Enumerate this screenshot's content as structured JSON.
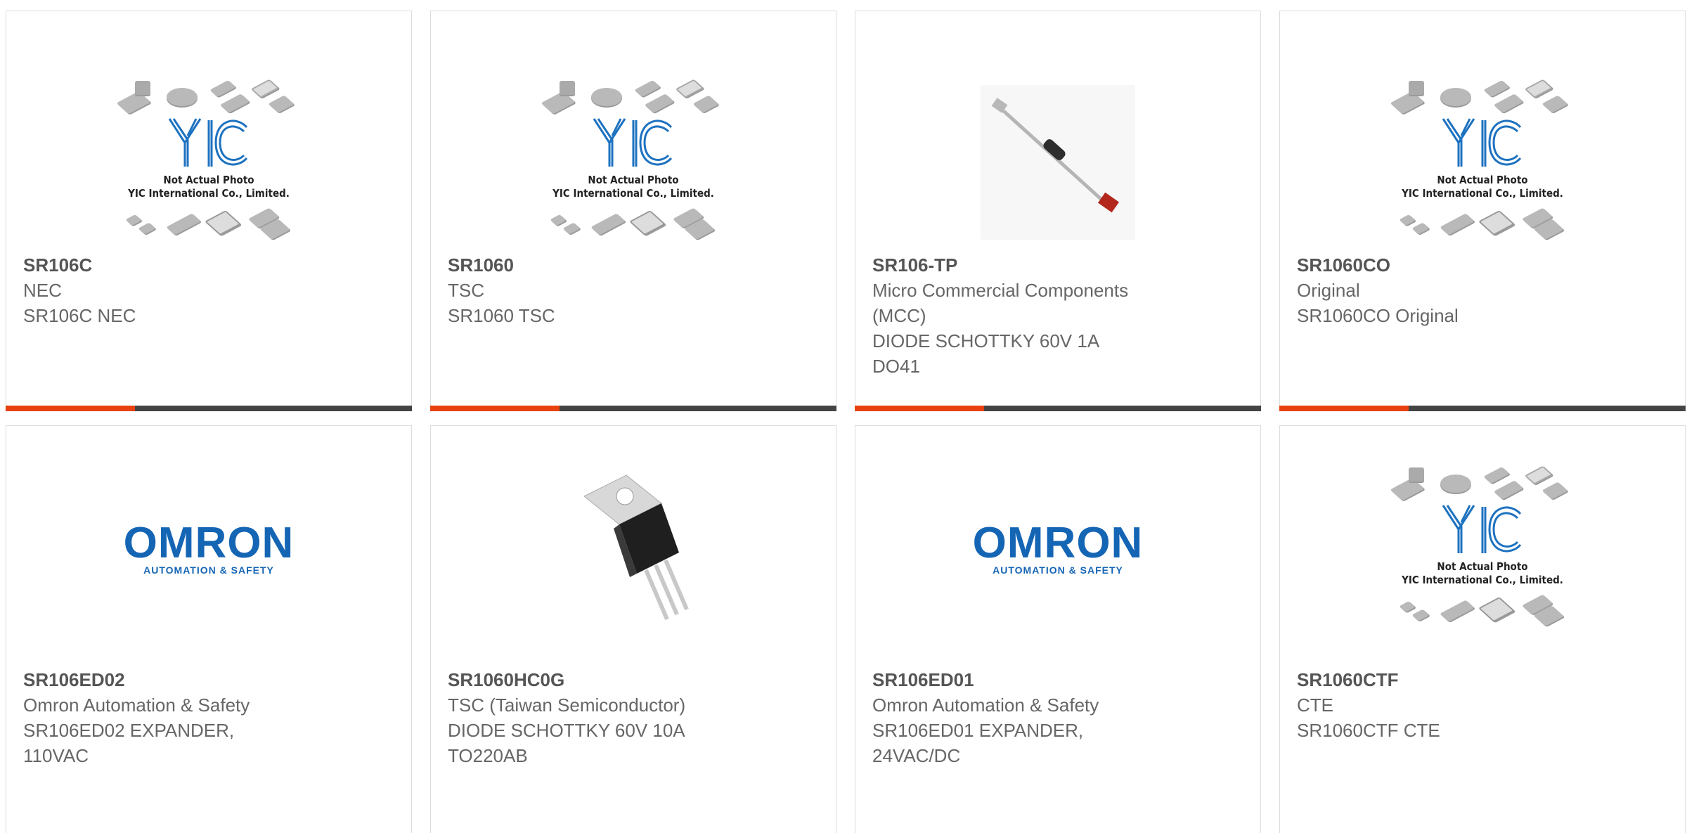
{
  "colors": {
    "accent": "#e8410e",
    "bar": "#444444",
    "border": "#dcdcdc"
  },
  "placeholder": {
    "line1": "Not Actual Photo",
    "line2": "YIC International Co., Limited."
  },
  "omron_logo": {
    "name": "OMRON",
    "tagline": "AUTOMATION & SAFETY"
  },
  "products": [
    {
      "part": "SR106C",
      "manufacturer": "NEC",
      "description": "SR106C NEC",
      "image": "placeholder-icon"
    },
    {
      "part": "SR1060",
      "manufacturer": "TSC",
      "description": "SR1060 TSC",
      "image": "placeholder-icon"
    },
    {
      "part": "SR106-TP",
      "manufacturer": "Micro Commercial Components\n(MCC)",
      "description": "DIODE SCHOTTKY 60V 1A\nDO41",
      "image": "axial-diode-icon"
    },
    {
      "part": "SR1060CO",
      "manufacturer": "Original",
      "description": "SR1060CO Original",
      "image": "placeholder-icon"
    },
    {
      "part": "SR106ED02",
      "manufacturer": "Omron Automation & Safety",
      "description": "SR106ED02 EXPANDER,\n110VAC",
      "image": "omron-logo"
    },
    {
      "part": "SR1060HC0G",
      "manufacturer": "TSC (Taiwan Semiconductor)",
      "description": "DIODE SCHOTTKY 60V 10A\nTO220AB",
      "image": "to220-package-icon"
    },
    {
      "part": "SR106ED01",
      "manufacturer": "Omron Automation & Safety",
      "description": "SR106ED01 EXPANDER,\n24VAC/DC",
      "image": "omron-logo"
    },
    {
      "part": "SR1060CTF",
      "manufacturer": "CTE",
      "description": "SR1060CTF CTE",
      "image": "placeholder-icon"
    }
  ]
}
